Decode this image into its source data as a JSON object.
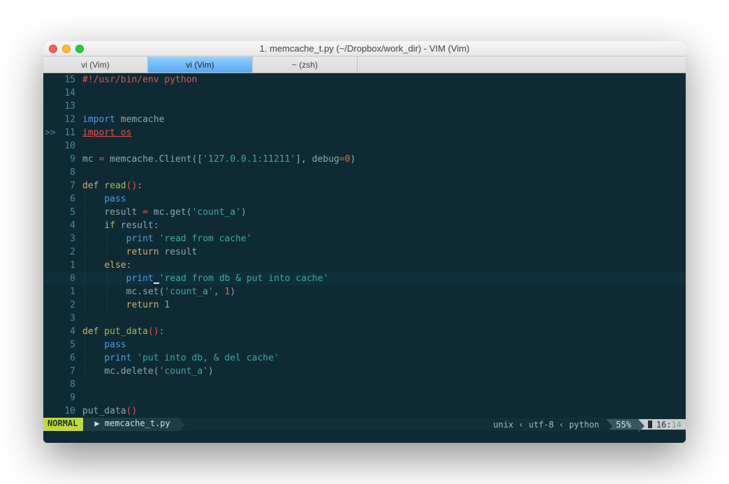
{
  "window": {
    "title": "1. memcache_t.py (~/Dropbox/work_dir) - VIM (Vim)"
  },
  "tabs": [
    {
      "label": "vi (Vim)",
      "active": false
    },
    {
      "label": "vi (Vim)",
      "active": true
    },
    {
      "label": "~ (zsh)",
      "active": false
    }
  ],
  "gutter": {
    "marker": ">>",
    "numbers": [
      "15",
      "14",
      "13",
      "12",
      "11",
      "10",
      "9",
      "8",
      "7",
      "6",
      "5",
      "4",
      "3",
      "2",
      "1",
      "0",
      "1",
      "2",
      "3",
      "4",
      "5",
      "6",
      "7",
      "8",
      "9",
      "10"
    ]
  },
  "status": {
    "mode": "NORMAL",
    "filename": "memcache_t.py",
    "fileformat": "unix",
    "encoding": "utf-8",
    "filetype": "python",
    "percent": "55%",
    "line": "16",
    "col": "14",
    "sep_left_angle": "‹",
    "sep_right": "▶"
  },
  "code": {
    "shebang_hash": "#!",
    "shebang_path": "/usr/bin/env python",
    "kw_import": "import",
    "mod_memcache": " memcache",
    "mod_os": " os",
    "var_mc": "mc ",
    "op_eq": "=",
    "expr_memcache_client": " memcache.Client([",
    "str_host": "'127.0.0.1:11211'",
    "expr_debug": "], debug",
    "num_zero": "0",
    "paren_close": ")",
    "kw_def": "def",
    "fn_read": " read",
    "parens": "()",
    "colon": ":",
    "kw_pass": "pass",
    "var_result": "result ",
    "expr_mc_get": " mc.get(",
    "str_count_a": "'count_a'",
    "kw_if": "if",
    "expr_result_colon": " result:",
    "kw_print": "print",
    "str_read_cache": "'read from cache'",
    "kw_return": "return",
    "expr_return_result": " result",
    "kw_else": "else",
    "str_read_db": "'read from db & put into cache'",
    "expr_mc_set": "mc.set(",
    "num_one": "1",
    "comma_sp": ", ",
    "expr_return_1": " 1",
    "fn_put_data": " put_data",
    "str_put_db": "'put into db, & del cache'",
    "expr_mc_delete": "mc.delete(",
    "call_put_data": "put_data",
    "sp1": " ",
    "sp4": "    "
  }
}
